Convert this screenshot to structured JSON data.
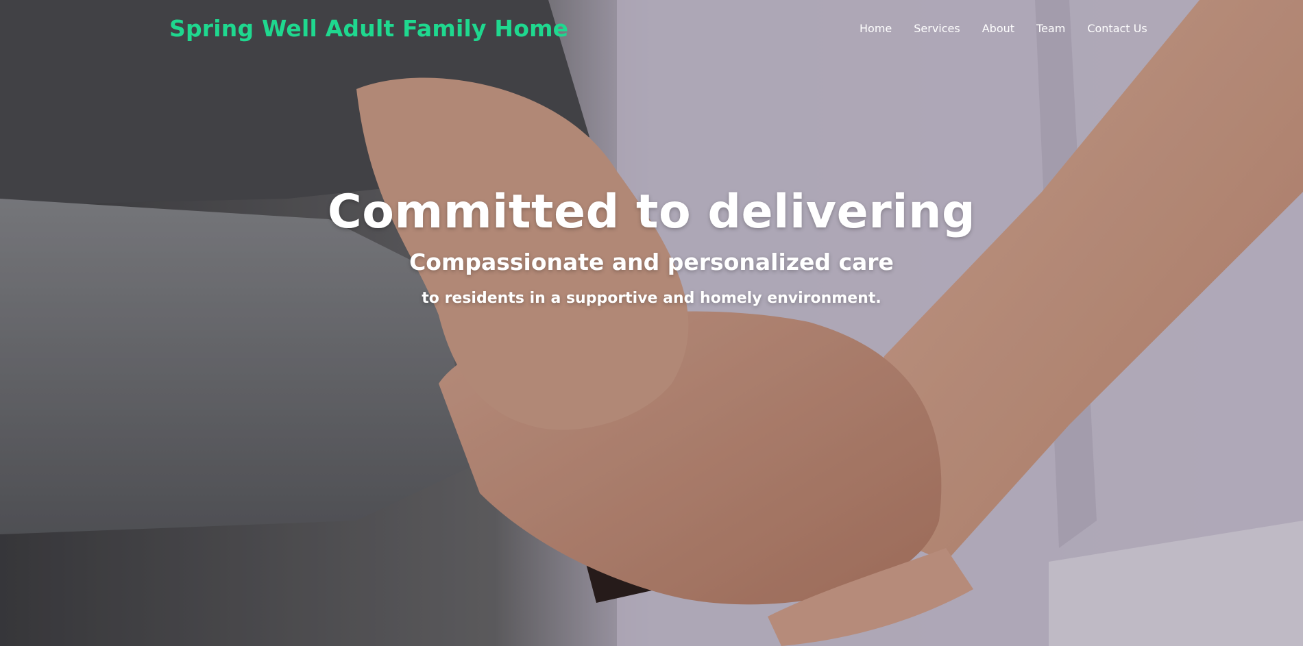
{
  "brand": {
    "title": "Spring Well Adult Family Home",
    "color": "#1fd88f"
  },
  "nav": {
    "items": [
      {
        "label": "Home"
      },
      {
        "label": "Services"
      },
      {
        "label": "About"
      },
      {
        "label": "Team"
      },
      {
        "label": "Contact Us"
      }
    ]
  },
  "hero": {
    "headline": "Committed to delivering",
    "subheadline": "Compassionate and personalized care",
    "tagline": "to residents in a supportive and homely environment.",
    "background": "photo of a caregiver's hands holding an elderly person's hands resting on a walking cane"
  }
}
